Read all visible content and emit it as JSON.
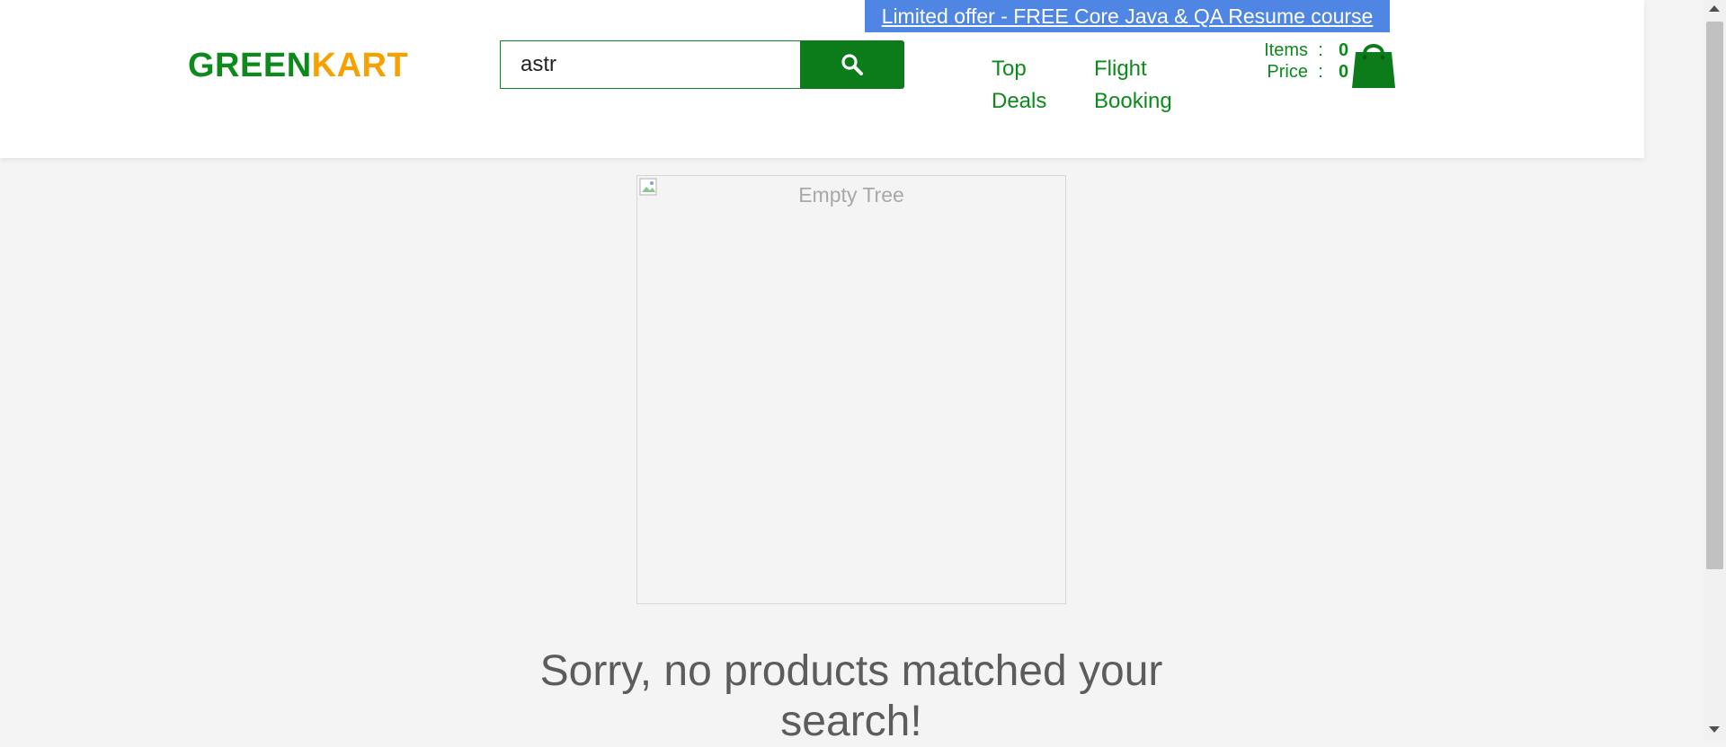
{
  "promo": {
    "text": "Limited offer - FREE Core Java & QA Resume course"
  },
  "logo": {
    "part1": "GREEN",
    "part2": "KART"
  },
  "search": {
    "value": "astr",
    "button_icon": "search-icon"
  },
  "nav": {
    "top_deals": "Top Deals",
    "flight_booking": "Flight Booking"
  },
  "cart": {
    "items_label": "Items",
    "items_value": "0",
    "price_label": "Price",
    "price_value": "0",
    "separator": ":",
    "icon": "shopping-bag-icon"
  },
  "main": {
    "image_alt": "Empty Tree",
    "no_results": "Sorry, no products matched your search!"
  },
  "colors": {
    "brand_green": "#0c8a1c",
    "brand_orange": "#f7a100",
    "promo_blue": "#4f86e4",
    "background": "#f4f4f4"
  }
}
